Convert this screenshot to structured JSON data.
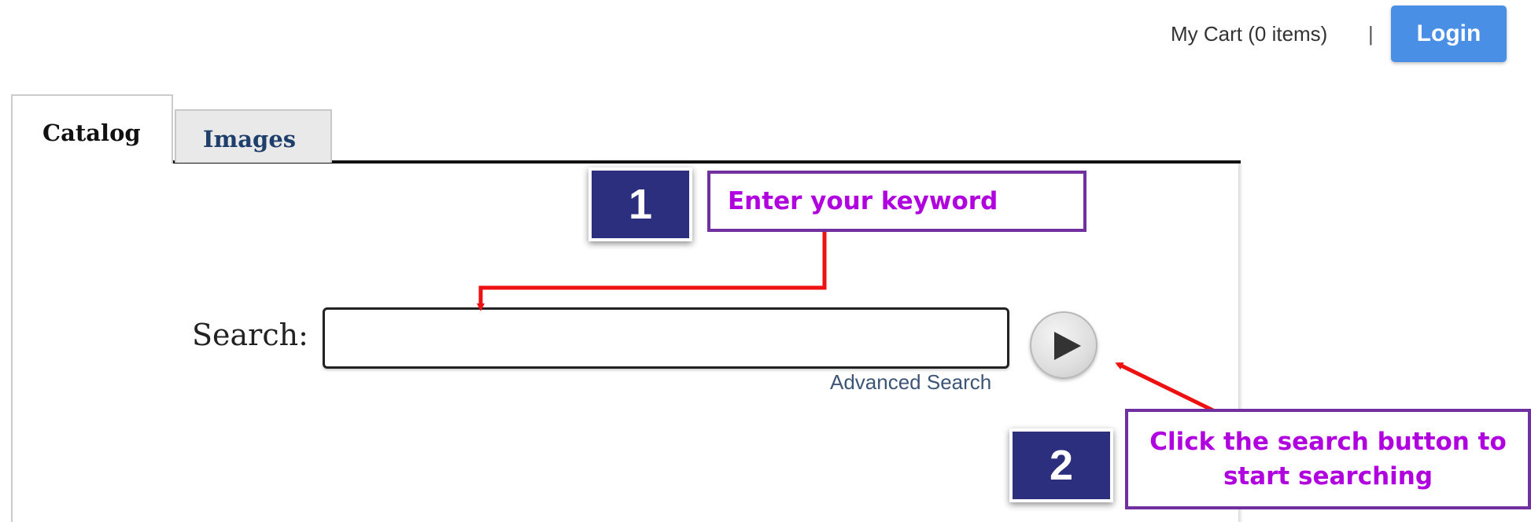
{
  "header": {
    "cart_label": "My Cart (0 items)",
    "separator": "|",
    "login_label": "Login"
  },
  "tabs": [
    {
      "label": "Catalog",
      "active": true
    },
    {
      "label": "Images",
      "active": false
    }
  ],
  "search": {
    "label": "Search:",
    "value": "",
    "advanced_link": "Advanced Search",
    "go_icon": "play-triangle-icon"
  },
  "annotations": {
    "step1": {
      "number": "1",
      "text": "Enter your keyword"
    },
    "step2": {
      "number": "2",
      "line1": "Click the search button to",
      "line2": "start searching"
    }
  },
  "colors": {
    "login_button": "#4a8fe6",
    "step_badge": "#2b2f7e",
    "callout_border": "#7030a0",
    "callout_text": "#b000e0",
    "arrow": "#ee1111",
    "tab_label_blue": "#1e3f6b"
  }
}
